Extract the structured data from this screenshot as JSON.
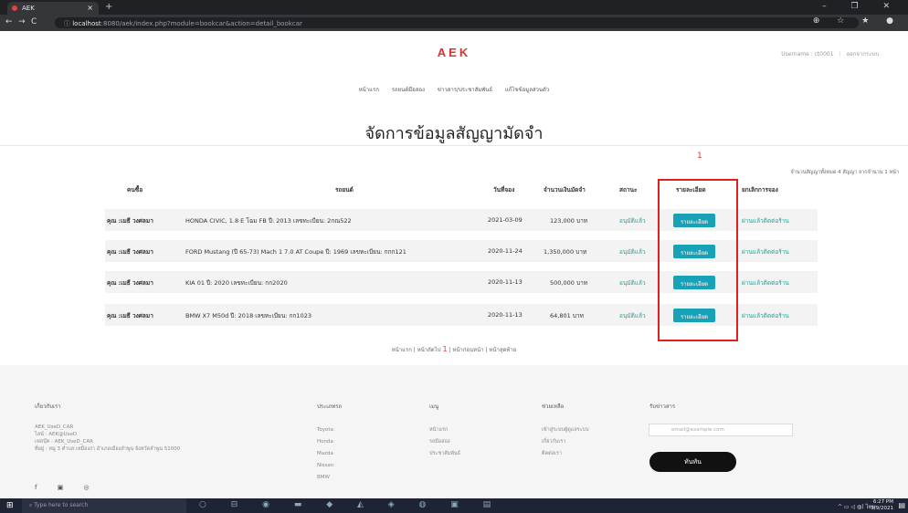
{
  "browser": {
    "tab_title": "AEK",
    "tab_close": "×",
    "new_tab": "+",
    "win_controls": "– ❐ ✕",
    "back": "←",
    "forward": "→",
    "reload": "C",
    "info": "ⓘ",
    "url_host": "localhost",
    "url_path": ":8080/aek/index.php?module=bookcar&action=detail_bookcar",
    "toolbar_right": "⊕ ☆ ★ ●"
  },
  "header": {
    "logo": "AEK",
    "nav": [
      "หน้าแรก",
      "รถยนต์มือสอง",
      "ข่าวสาร/ประชาสัมพันธ์",
      "แก้ไขข้อมูลส่วนตัว"
    ],
    "username": "Username : ct0001",
    "logout": "ออกจากระบบ"
  },
  "page": {
    "title": "จัดการข้อมูลสัญญามัดจำ",
    "current_page": "1",
    "summary": "จำนวนสัญญาทั้งหมด 4 สัญญา จากจำนวน 1 หน้า"
  },
  "table": {
    "headers": [
      "คนซื้อ",
      "รถยนต์",
      "วันที่จอง",
      "จำนวนเงินมัดจำ",
      "สถานะ",
      "รายละเอียด",
      "ยกเลิกการจอง"
    ],
    "rows": [
      {
        "buyer": "คุณ :เมธี วงศลมา",
        "car": "HONDA CIVIC, 1.8 E โฉม FB ปี: 2013 เลขทะเบียน: 2กณ522",
        "date": "2021-03-09",
        "amount": "123,000 บาท",
        "status": "อนุมัติแล้ว",
        "detail": "รายละเอียด",
        "cancel": "ผ่านแล้วติดต่อร้าน"
      },
      {
        "buyer": "คุณ :เมธี วงศลมา",
        "car": "FORD Mustang (ปี 65-73) Mach 1 7.0 AT Coupe ปี: 1969 เลขทะเบียน: กกก121",
        "date": "2020-11-24",
        "amount": "1,350,000 บาท",
        "status": "อนุมัติแล้ว",
        "detail": "รายละเอียด",
        "cancel": "ผ่านแล้วติดต่อร้าน"
      },
      {
        "buyer": "คุณ :เมธี วงศลมา",
        "car": "KIA 01 ปี: 2020 เลขทะเบียน: กก2020",
        "date": "2020-11-13",
        "amount": "500,000 บาท",
        "status": "อนุมัติแล้ว",
        "detail": "รายละเอียด",
        "cancel": "ผ่านแล้วติดต่อร้าน"
      },
      {
        "buyer": "คุณ :เมธี วงศลมา",
        "car": "BMW X7 M50d ปี: 2018 เลขทะเบียน: กก1023",
        "date": "2020-11-13",
        "amount": "64,801 บาท",
        "status": "อนุมัติแล้ว",
        "detail": "รายละเอียด",
        "cancel": "ผ่านแล้วติดต่อร้าน"
      }
    ]
  },
  "pager": {
    "first": "หน้าแรก",
    "next": "หน้าถัดไป",
    "current": "1",
    "prev": "หน้าก่อนหน้า",
    "last": "หน้าสุดท้าย"
  },
  "footer": {
    "about_title": "เกี่ยวกับเรา",
    "about_lines": [
      "AEK_UseD_CAR",
      "ไลน์ : AEK@UseD",
      "เฟสบุ๊ค : AEK_UseD_CAR",
      "ที่อยู่ : หมู่ 3 ตำบล เหมืองง่า อำเภอเมืองลำพูน จังหวัดลำพูน 51000"
    ],
    "brands_title": "ประเภทรถ",
    "brands": [
      "Toyota",
      "Honda",
      "Mazda",
      "Nissan",
      "BMW"
    ],
    "menu_title": "เมนู",
    "menu": [
      "หน้าแรก",
      "รถมือสอง",
      "ประชาสัมพันธ์"
    ],
    "help_title": "ช่วยเหลือ",
    "help": [
      "เข้าสู่ระบบผู้ดูแลระบบ",
      "เกี่ยวกับเรา",
      "ติดต่อเรา"
    ],
    "news_title": "รับข่าวสาร",
    "email_placeholder": "email@example.com",
    "subscribe": "ทันทัน",
    "social": "f ▣ ◎"
  },
  "taskbar": {
    "start": "⊞",
    "search_placeholder": "⌕  Type here to search",
    "apps": "○ ⊟ ◉ ▬ ◆ ◭ ◈ ◍ ▣ ▤",
    "tray": "^ ▭ ◁ ◍) ไทย",
    "time": "6:27 PM",
    "date": "3/9/2021",
    "notification": "▤"
  }
}
